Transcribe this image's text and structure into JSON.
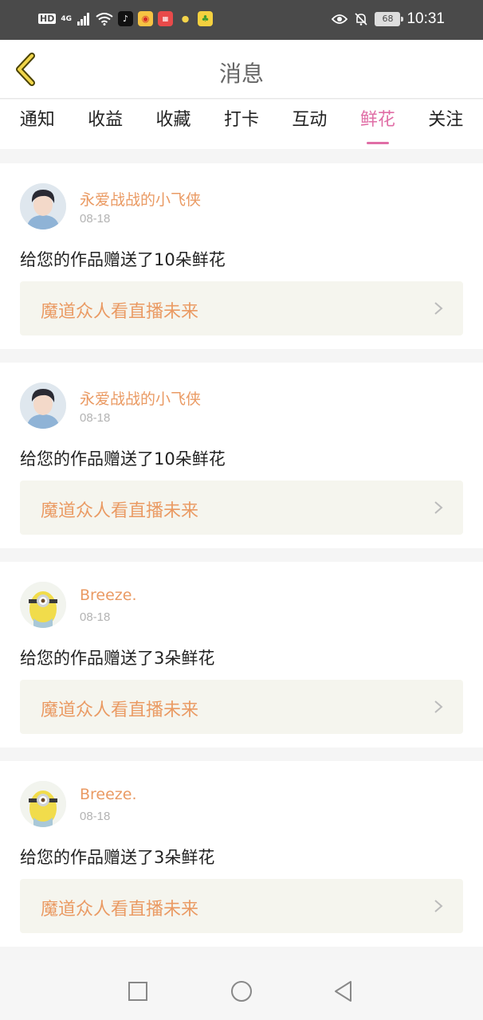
{
  "status_bar": {
    "hd": "HD",
    "network": "4G",
    "battery": "68",
    "time": "10:31",
    "icons": [
      "signal-icon",
      "wifi-icon",
      "tiktok-icon",
      "weibo-icon",
      "app-red-icon",
      "lightbulb-icon",
      "pineapple-icon",
      "eye-icon",
      "bell-off-icon",
      "battery-icon"
    ]
  },
  "header": {
    "title": "消息",
    "back_icon": "chevron-left-icon"
  },
  "tabs": [
    {
      "label": "通知"
    },
    {
      "label": "收益"
    },
    {
      "label": "收藏"
    },
    {
      "label": "打卡"
    },
    {
      "label": "互动"
    },
    {
      "label": "鲜花",
      "active": true
    },
    {
      "label": "关注"
    }
  ],
  "feed": [
    {
      "user": "永爱战战的小飞侠",
      "date": "08-18",
      "message": "给您的作品赠送了10朵鲜花",
      "work": "魔道众人看直播未来"
    },
    {
      "user": "永爱战战的小飞侠",
      "date": "08-18",
      "message": "给您的作品赠送了10朵鲜花",
      "work": "魔道众人看直播未来"
    },
    {
      "user": "Breeze.",
      "date": "08-18",
      "message": "给您的作品赠送了3朵鲜花",
      "work": "魔道众人看直播未来"
    },
    {
      "user": "Breeze.",
      "date": "08-18",
      "message": "给您的作品赠送了3朵鲜花",
      "work": "魔道众人看直播未来"
    }
  ],
  "colors": {
    "accent_pink": "#e06ea6",
    "name_orange": "#ea9a63",
    "link_bg": "#f5f5ee",
    "status_bar": "#4a4a4a"
  },
  "system_nav": [
    "recent-apps-icon",
    "home-icon",
    "back-icon"
  ]
}
